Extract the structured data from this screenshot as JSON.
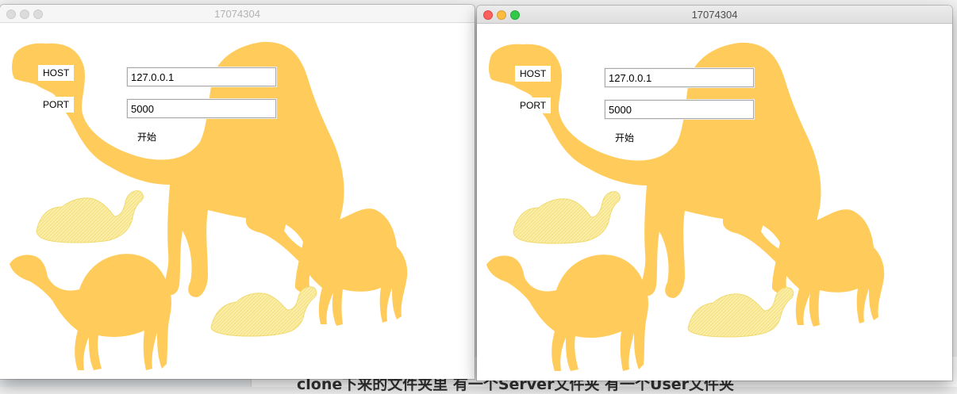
{
  "background": {
    "text": "clone下来的文件夹里 有一个Server文件夹 有一个User文件夹"
  },
  "windows": [
    {
      "title": "17074304",
      "active": false,
      "host_label": "HOST",
      "host_value": "127.0.0.1",
      "port_label": "PORT",
      "port_value": "5000",
      "start_label": "开始"
    },
    {
      "title": "17074304",
      "active": true,
      "host_label": "HOST",
      "host_value": "127.0.0.1",
      "port_label": "PORT",
      "port_value": "5000",
      "start_label": "开始"
    }
  ],
  "colors": {
    "camel": "#ffcc5b",
    "camel_pale": "#f8e38a",
    "close": "#fc605c",
    "minimize": "#fdbc40",
    "maximize": "#34c84a"
  },
  "icons": [
    "camel-silhouette"
  ]
}
